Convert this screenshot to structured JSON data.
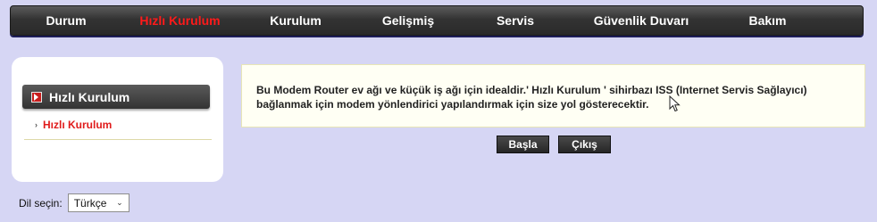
{
  "nav": {
    "items": [
      {
        "label": "Durum",
        "active": false
      },
      {
        "label": "Hızlı Kurulum",
        "active": true
      },
      {
        "label": "Kurulum",
        "active": false
      },
      {
        "label": "Gelişmiş",
        "active": false
      },
      {
        "label": "Servis",
        "active": false
      },
      {
        "label": "Güvenlik Duvarı",
        "active": false
      },
      {
        "label": "Bakım",
        "active": false
      }
    ]
  },
  "sidebar": {
    "header": "Hızlı Kurulum",
    "links": [
      {
        "label": "Hızlı Kurulum"
      }
    ]
  },
  "language": {
    "label": "Dil seçin:",
    "selected": "Türkçe"
  },
  "main": {
    "description": "Bu Modem Router ev ağı ve küçük iş ağı için idealdir.' Hızlı Kurulum ' sihirbazı ISS (Internet Servis Sağlayıcı) bağlanmak için modem yönlendirici yapılandırmak için size yol gösterecektir."
  },
  "buttons": {
    "start": "Başla",
    "exit": "Çıkış"
  },
  "colors": {
    "background": "#d6d6f4",
    "nav_active": "#ff1a1a",
    "link": "#e01b1b",
    "header_dark": "#333333"
  }
}
